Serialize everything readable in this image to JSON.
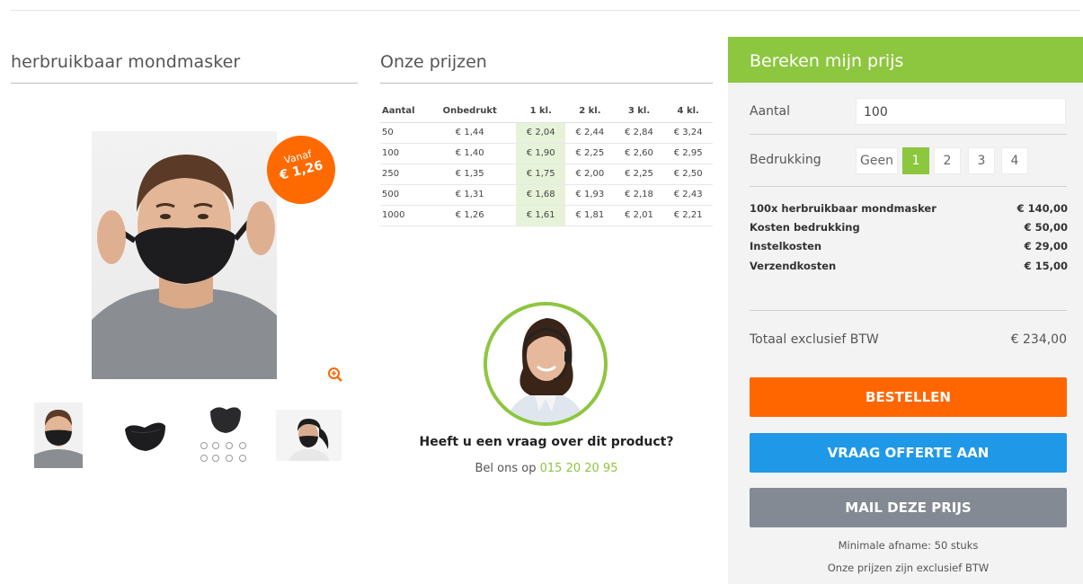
{
  "product": {
    "title": "herbruikbaar mondmasker",
    "badge_line1": "Vanaf",
    "badge_line2": "€ 1,26"
  },
  "prices": {
    "title": "Onze prijzen",
    "headers": [
      "Aantal",
      "Onbedrukt",
      "1 kl.",
      "2 kl.",
      "3 kl.",
      "4 kl."
    ],
    "rows": [
      [
        "50",
        "€ 1,44",
        "€ 2,04",
        "€ 2,44",
        "€ 2,84",
        "€ 3,24"
      ],
      [
        "100",
        "€ 1,40",
        "€ 1,90",
        "€ 2,25",
        "€ 2,60",
        "€ 2,95"
      ],
      [
        "250",
        "€ 1,35",
        "€ 1,75",
        "€ 2,00",
        "€ 2,25",
        "€ 2,50"
      ],
      [
        "500",
        "€ 1,31",
        "€ 1,68",
        "€ 1,93",
        "€ 2,18",
        "€ 2,43"
      ],
      [
        "1000",
        "€ 1,26",
        "€ 1,61",
        "€ 1,81",
        "€ 2,01",
        "€ 2,21"
      ]
    ]
  },
  "support": {
    "question": "Heeft u een vraag over dit product?",
    "call_prefix": "Bel ons op",
    "phone": "015 20 20 95"
  },
  "calculator": {
    "title": "Bereken mijn prijs",
    "quantity_label": "Aantal",
    "quantity_value": "100",
    "print_label": "Bedrukking",
    "print_options": [
      "Geen",
      "1",
      "2",
      "3",
      "4"
    ],
    "print_selected": "1",
    "costs": [
      {
        "label": "100x herbruikbaar mondmasker",
        "value": "€ 140,00"
      },
      {
        "label": "Kosten bedrukking",
        "value": "€ 50,00"
      },
      {
        "label": "Instelkosten",
        "value": "€ 29,00"
      },
      {
        "label": "Verzendkosten",
        "value": "€ 15,00"
      }
    ],
    "total_label": "Totaal exclusief BTW",
    "total_value": "€ 234,00",
    "order_button": "BESTELLEN",
    "quote_button": "VRAAG OFFERTE AAN",
    "mail_button": "MAIL DEZE PRIJS",
    "note_min": "Minimale afname: 50 stuks",
    "note_vat": "Onze prijzen zijn exclusief BTW"
  },
  "colors": {
    "accent_green": "#8dc63f",
    "order_orange": "#ff6600",
    "quote_blue": "#1f98e8",
    "mail_grey": "#838a93"
  }
}
